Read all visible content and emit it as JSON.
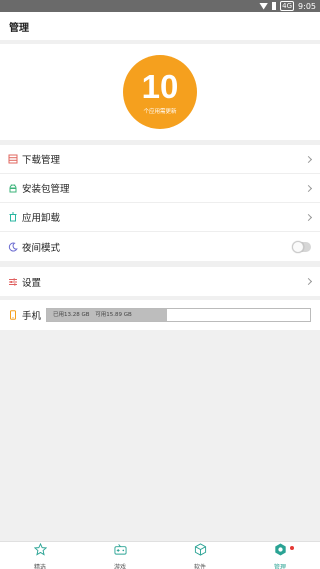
{
  "status_bar": {
    "badge": "4G",
    "time": "9:05"
  },
  "header": {
    "title": "管理"
  },
  "hero": {
    "count": "10",
    "subtitle": "个应用需更新"
  },
  "menu": {
    "items": [
      {
        "label": "下载管理",
        "icon": "download-list-icon",
        "color": "#e0675f"
      },
      {
        "label": "安装包管理",
        "icon": "android-package-icon",
        "color": "#3bb37a"
      },
      {
        "label": "应用卸载",
        "icon": "trash-icon",
        "color": "#29b6a0"
      },
      {
        "label": "夜间模式",
        "icon": "moon-icon",
        "color": "#6a6ad0",
        "toggle": false
      }
    ]
  },
  "settings": {
    "label": "设置",
    "icon": "sliders-icon",
    "color": "#e06060"
  },
  "storage": {
    "label": "手机",
    "icon": "phone-icon",
    "icon_color": "#f5a01e",
    "used": "已用13.28 GB",
    "free": "可用15.89 GB",
    "used_fraction": 0.455
  },
  "tabs": [
    {
      "label": "精选",
      "icon": "star-icon",
      "active": false
    },
    {
      "label": "游戏",
      "icon": "gamepad-icon",
      "active": false
    },
    {
      "label": "软件",
      "icon": "cube-icon",
      "active": false
    },
    {
      "label": "管理",
      "icon": "gear-icon",
      "active": true,
      "badge_dot": true
    }
  ],
  "colors": {
    "accent": "#2aa394",
    "hero": "#f5a01e",
    "badge": "#e53935"
  }
}
